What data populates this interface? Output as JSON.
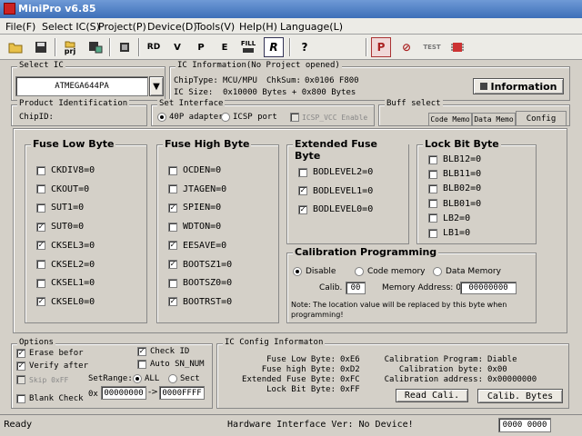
{
  "window": {
    "title": "MiniPro v6.85"
  },
  "menu": [
    "File(F)",
    "Select IC(S)",
    "Project(P)",
    "Device(D)",
    "Tools(V)",
    "Help(H)",
    "Language(L)"
  ],
  "toolbar": {
    "prj_label": "prj",
    "fill_label": "FILL",
    "test_label": "TEST"
  },
  "select_ic": {
    "label": "Select IC",
    "value": "ATMEGA644PA"
  },
  "ic_info": {
    "label": "IC Information(No Project opened)",
    "chiptype_label": "ChipType:",
    "chiptype": "MCU/MPU",
    "chksum_label": "ChkSum:",
    "chksum": "0x0106 F800",
    "icsize_label": "IC Size:",
    "icsize": "0x10000 Bytes + 0x800 Bytes",
    "button": "Information"
  },
  "product_id": {
    "label": "Product Identification",
    "chipid_label": "ChipID:"
  },
  "interface": {
    "label": "Set Interface",
    "opt1": "40P adapter",
    "opt2": "ICSP port",
    "opt3": "ICSP_VCC Enable"
  },
  "buff": {
    "label": "Buff select",
    "tabs": [
      "Code Memo",
      "Data Memo",
      "Config"
    ]
  },
  "fuse_low": {
    "title": "Fuse Low Byte",
    "items": [
      {
        "label": "CKDIV8=0",
        "checked": false
      },
      {
        "label": "CKOUT=0",
        "checked": false
      },
      {
        "label": "SUT1=0",
        "checked": false
      },
      {
        "label": "SUT0=0",
        "checked": true
      },
      {
        "label": "CKSEL3=0",
        "checked": true
      },
      {
        "label": "CKSEL2=0",
        "checked": false
      },
      {
        "label": "CKSEL1=0",
        "checked": false
      },
      {
        "label": "CKSEL0=0",
        "checked": true
      }
    ]
  },
  "fuse_high": {
    "title": "Fuse High Byte",
    "items": [
      {
        "label": "OCDEN=0",
        "checked": false
      },
      {
        "label": "JTAGEN=0",
        "checked": false
      },
      {
        "label": "SPIEN=0",
        "checked": true
      },
      {
        "label": "WDTON=0",
        "checked": false
      },
      {
        "label": "EESAVE=0",
        "checked": true
      },
      {
        "label": "BOOTSZ1=0",
        "checked": true
      },
      {
        "label": "BOOTSZ0=0",
        "checked": false
      },
      {
        "label": "BOOTRST=0",
        "checked": true
      }
    ]
  },
  "ext_fuse": {
    "title": "Extended Fuse Byte",
    "items": [
      {
        "label": "BODLEVEL2=0",
        "checked": false
      },
      {
        "label": "BODLEVEL1=0",
        "checked": true
      },
      {
        "label": "BODLEVEL0=0",
        "checked": true
      }
    ]
  },
  "lock_bit": {
    "title": "Lock Bit Byte",
    "items": [
      {
        "label": "BLB12=0",
        "checked": false
      },
      {
        "label": "BLB11=0",
        "checked": false
      },
      {
        "label": "BLB02=0",
        "checked": false
      },
      {
        "label": "BLB01=0",
        "checked": false
      },
      {
        "label": "LB2=0",
        "checked": false
      },
      {
        "label": "LB1=0",
        "checked": false
      }
    ]
  },
  "calibration": {
    "title": "Calibration Programming",
    "disable": "Disable",
    "code_memory": "Code memory",
    "data_memory": "Data Memory",
    "calib_label": "Calib.",
    "calib_value": "00",
    "mem_addr_label": "Memory Address: 0x",
    "mem_addr_value": "00000000",
    "note": "Note: The location value will be replaced by this byte  when programming!"
  },
  "options": {
    "label": "Options",
    "erase": "Erase befor",
    "verify": "Verify after",
    "skip": "Skip 0xFF",
    "blank": "Blank Check",
    "checkid": "Check ID",
    "auto_sn": "Auto SN_NUM",
    "setrange": "SetRange:",
    "all": "ALL",
    "sect": "Sect",
    "range_prefix": "0x",
    "range_from": "00000000",
    "range_to": "0000FFFF"
  },
  "ic_config": {
    "label": "IC Config Informaton",
    "fuse_low_label": "Fuse Low Byte:",
    "fuse_low": "0xE6",
    "fuse_high_label": "Fuse high Byte:",
    "fuse_high": "0xD2",
    "ext_label": "Extended Fuse Byte:",
    "ext": "0xFC",
    "lock_label": "Lock Bit Byte:",
    "lock": "0xFF",
    "calprog_label": "Calibration Program:",
    "calprog": "Diable",
    "calbyte_label": "Calibration byte:",
    "calbyte": "0x00",
    "caladdr_label": "Calibration address:",
    "caladdr": "0x00000000",
    "read_button": "Read Cali.",
    "calib_button": "Calib. Bytes"
  },
  "status": {
    "left": "Ready",
    "center": "Hardware Interface Ver: No Device!",
    "right": "0000 0000"
  }
}
